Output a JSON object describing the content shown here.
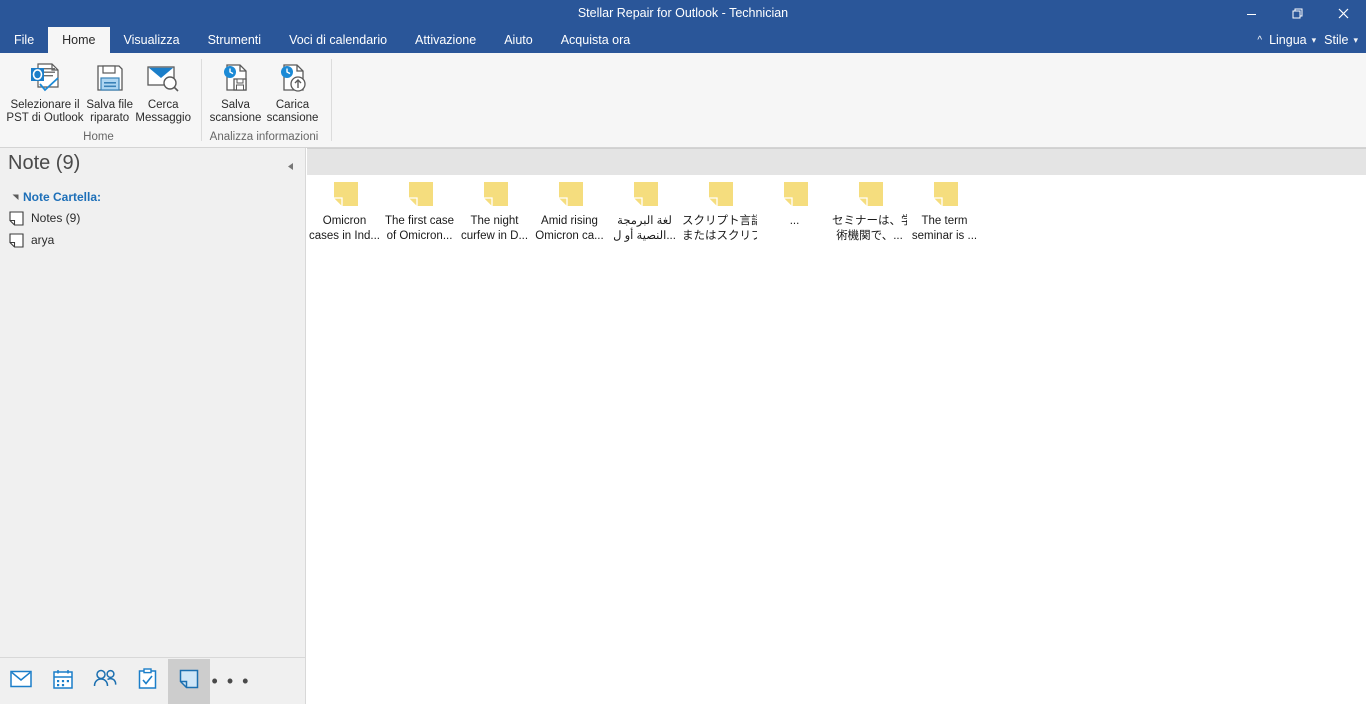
{
  "window": {
    "title": "Stellar Repair for Outlook - Technician",
    "controls": [
      {
        "name": "minimize-button",
        "glyph": "minimize"
      },
      {
        "name": "restore-button",
        "glyph": "restore"
      },
      {
        "name": "close-button",
        "glyph": "close"
      }
    ]
  },
  "ribbon": {
    "tabs": [
      {
        "label": "File",
        "active": false
      },
      {
        "label": "Home",
        "active": true
      },
      {
        "label": "Visualizza",
        "active": false
      },
      {
        "label": "Strumenti",
        "active": false
      },
      {
        "label": "Voci di calendario",
        "active": false
      },
      {
        "label": "Attivazione",
        "active": false
      },
      {
        "label": "Aiuto",
        "active": false
      },
      {
        "label": "Acquista ora",
        "active": false
      }
    ],
    "right_controls": {
      "collapse_caret": "^",
      "language_label": "Lingua",
      "language_caret": "▾",
      "style_label": "Stile",
      "style_caret": "▾"
    },
    "groups": [
      {
        "title": "Home",
        "items": [
          {
            "label_line1": "Selezionare il",
            "label_line2": "PST di Outlook",
            "icon": "outlook-pst-icon"
          },
          {
            "label_line1": "Salva file",
            "label_line2": "riparato",
            "icon": "floppy-save-icon"
          },
          {
            "label_line1": "Cerca",
            "label_line2": "Messaggio",
            "icon": "envelope-search-icon"
          }
        ]
      },
      {
        "title": "Analizza informazioni",
        "items": [
          {
            "label_line1": "Salva",
            "label_line2": "scansione",
            "icon": "save-scan-icon"
          },
          {
            "label_line1": "Carica",
            "label_line2": "scansione",
            "icon": "load-scan-icon"
          }
        ]
      }
    ]
  },
  "left_pane": {
    "title": "Note (9)",
    "collapse_icon": "collapse-left-icon",
    "tree": {
      "root_label": "Note Cartella:",
      "items": [
        {
          "label": "Notes (9)",
          "icon": "note-icon"
        },
        {
          "label": "arya",
          "icon": "note-icon"
        }
      ]
    }
  },
  "bottom_nav": {
    "items": [
      {
        "name": "mail",
        "icon": "envelope-icon",
        "active": false
      },
      {
        "name": "calendar",
        "icon": "calendar-icon",
        "active": false
      },
      {
        "name": "people",
        "icon": "people-icon",
        "active": false
      },
      {
        "name": "tasks",
        "icon": "clipboard-check-icon",
        "active": false
      },
      {
        "name": "notes",
        "icon": "note-icon",
        "active": true
      }
    ],
    "overflow_label": "• • •"
  },
  "notes": [
    {
      "line1": "Omicron",
      "line2": "cases in Ind..."
    },
    {
      "line1": "The first case",
      "line2": "of Omicron..."
    },
    {
      "line1": "The night",
      "line2": "curfew in D..."
    },
    {
      "line1": "Amid rising",
      "line2": "Omicron ca..."
    },
    {
      "line1": "لغة البرمجة",
      "line2": "النصية أو ل..."
    },
    {
      "line1": "スクリプト言語",
      "line2": "またはスクリプ..."
    },
    {
      "line1": "",
      "line2": "..."
    },
    {
      "line1": "セミナーは、学",
      "line2": "術機関で、..."
    },
    {
      "line1": "The term",
      "line2": "seminar is ..."
    }
  ],
  "colors": {
    "accent_blue": "#2a5699",
    "ribbon_bg": "#f6f6f6",
    "pane_bg": "#f0f0f0",
    "note_yellow": "#f5dd7e",
    "link_blue": "#1d6fb8",
    "band_gray": "#e4e4e4"
  }
}
